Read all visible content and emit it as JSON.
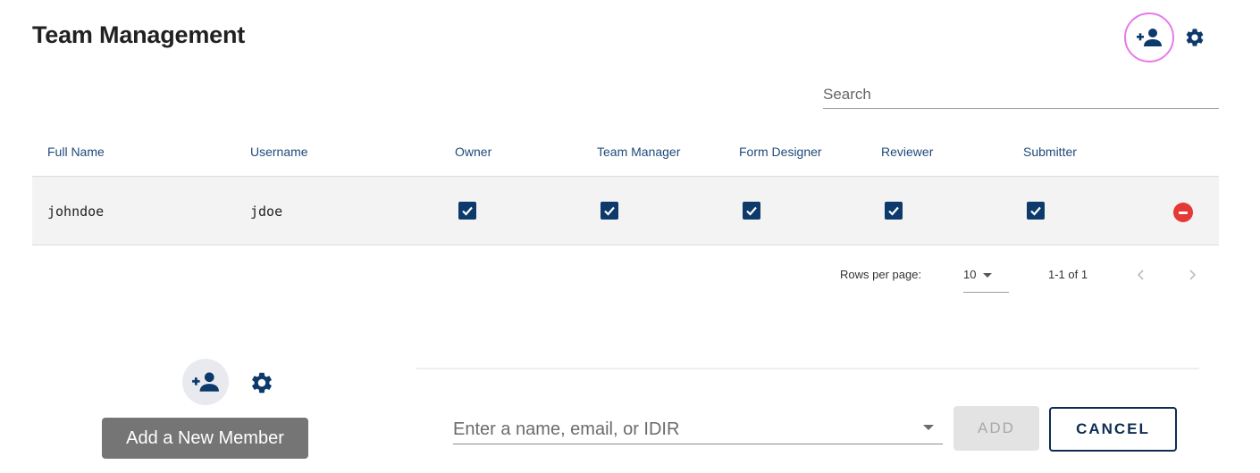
{
  "header": {
    "title": "Team Management",
    "add_icon": "person-add-icon",
    "settings_icon": "gear-icon"
  },
  "search": {
    "placeholder": "Search",
    "value": ""
  },
  "table": {
    "columns": [
      "Full Name",
      "Username",
      "Owner",
      "Team Manager",
      "Form Designer",
      "Reviewer",
      "Submitter"
    ],
    "rows": [
      {
        "full_name": "johndoe",
        "username": "jdoe",
        "owner": true,
        "team_manager": true,
        "form_designer": true,
        "reviewer": true,
        "submitter": true,
        "remove_icon": "remove-circle-icon"
      }
    ]
  },
  "pagination": {
    "rows_per_page_label": "Rows per page:",
    "rows_per_page": "10",
    "range": "1-1 of 1",
    "prev_icon": "chevron-left-icon",
    "next_icon": "chevron-right-icon"
  },
  "add_member": {
    "tooltip": "Add a New Member",
    "input_placeholder": "Enter a name, email, or IDIR",
    "add_label": "ADD",
    "cancel_label": "CANCEL"
  },
  "colors": {
    "accent_navy": "#0d3a6b",
    "header_blue": "#1f4a7a",
    "remove_red": "#e53935",
    "focus_ring": "#e879e8"
  }
}
